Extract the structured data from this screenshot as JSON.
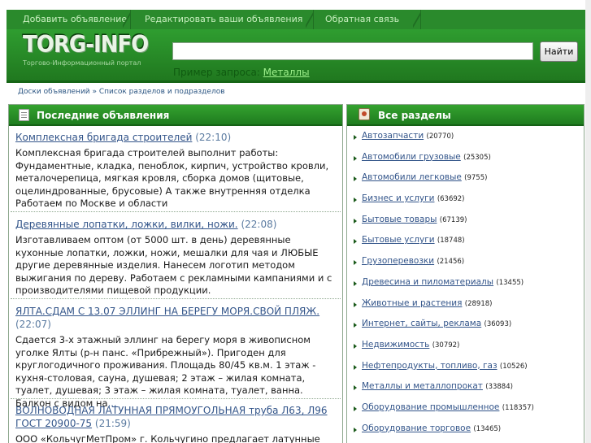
{
  "tabs": [
    "Добавить объявление",
    "Редактировать ваши объявления",
    "Обратная связь"
  ],
  "logo": {
    "text": "TORG-INFO",
    "subtitle": "Торгово-Информационный портал"
  },
  "search": {
    "placeholder": "",
    "button": "Найти",
    "example_label": "Пример запроса:",
    "example_value": "Металлы"
  },
  "breadcrumb": {
    "home": "Доски объявлений",
    "sep": " » ",
    "current": "Список разделов и подразделов"
  },
  "latest": {
    "title": "Последние объявления",
    "ads": [
      {
        "title": "Комплексная бригада строителей",
        "time": "(22:10)",
        "text": "Комплексная бригада строителей выполнит работы: Фундаментные, кладка, пеноблок, кирпич, устройство кровли, металочерепица, мягкая кровля, сборка домов (щитовые, оцелиндрованные, брусовые) А также внутренняя отделка Работаем по Москве и области"
      },
      {
        "title": "Деревянные лопатки, ложки, вилки, ножи.",
        "time": "(22:08)",
        "text": "Изготавливаем оптом (от 5000 шт. в день) деревянные кухонные лопатки, ложки, ножи, мешалки для чая и ЛЮБЫЕ другие деревянные изделия. Нанесем логотип методом выжигания по дереву. Работаем с рекламными кампаниями и с производителями пищевой продукции."
      },
      {
        "title": "ЯЛТА.СДАМ С 13.07 ЭЛЛИНГ НА БЕРЕГУ МОРЯ.СВОЙ ПЛЯЖ.",
        "time": "(22:07)",
        "text": "Сдается 3-х этажный эллинг на берегу моря в живописном уголке Ялты (р-н панс. «Прибрежный»). Пригоден для круглогодичного проживания. Площадь 80/45 кв.м. 1 этаж - кухня-столовая, сауна, душевая; 2 этаж – жилая комната, туалет, душевая; 3 этаж – жилая комната, туалет, ванна. Балкон с видом на",
        "more": "..."
      },
      {
        "title": "ВОЛНОВОДНАЯ ЛАТУННАЯ ПРЯМОУГОЛЬНАЯ труба Л63, Л96 ГОСТ 20900-75",
        "time": "(21:59)",
        "text": "ООО «КольчугМетПром» г. Кольчугино предлагает латунные"
      }
    ]
  },
  "sections": {
    "title": "Все разделы",
    "items": [
      {
        "name": "Автозапчасти",
        "count": "(20770)"
      },
      {
        "name": "Автомобили грузовые",
        "count": "(25305)"
      },
      {
        "name": "Автомобили легковые",
        "count": "(9755)"
      },
      {
        "name": "Бизнес и услуги",
        "count": "(63692)"
      },
      {
        "name": "Бытовые товары",
        "count": "(67139)"
      },
      {
        "name": "Бытовые услуги",
        "count": "(18748)"
      },
      {
        "name": "Грузоперевозки",
        "count": "(21456)"
      },
      {
        "name": "Древесина и пиломатериалы",
        "count": "(13455)"
      },
      {
        "name": "Животные и растения",
        "count": "(28918)"
      },
      {
        "name": "Интернет, сайты, реклама",
        "count": "(36093)"
      },
      {
        "name": "Недвижимость",
        "count": "(30792)"
      },
      {
        "name": "Нефтепродукты, топливо, газ",
        "count": "(10526)"
      },
      {
        "name": "Металлы и металлопрокат",
        "count": "(33884)"
      },
      {
        "name": "Оборудование промышленное",
        "count": "(118357)"
      },
      {
        "name": "Оборудование торговое",
        "count": "(13465)"
      }
    ]
  },
  "colors": {
    "header_green": "#2a8a2c",
    "link_blue": "#33558a"
  }
}
